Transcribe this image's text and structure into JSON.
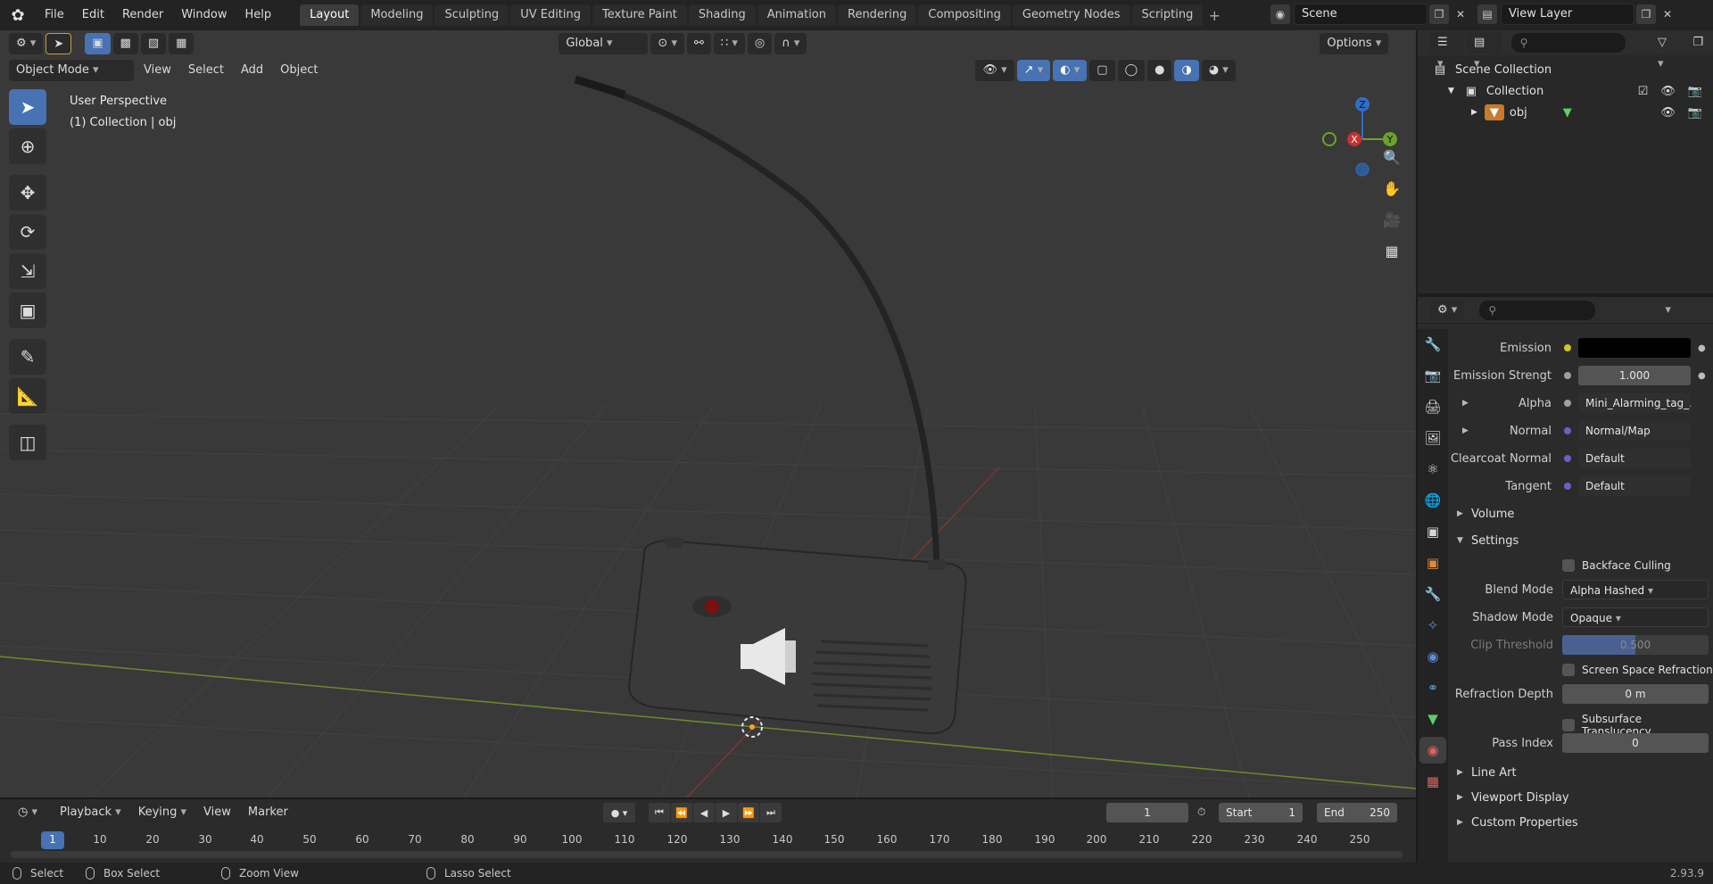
{
  "topbar": {
    "menus": [
      "File",
      "Edit",
      "Render",
      "Window",
      "Help"
    ],
    "workspaces": [
      "Layout",
      "Modeling",
      "Sculpting",
      "UV Editing",
      "Texture Paint",
      "Shading",
      "Animation",
      "Rendering",
      "Compositing",
      "Geometry Nodes",
      "Scripting"
    ],
    "active_workspace": "Layout",
    "scene": "Scene",
    "view_layer": "View Layer"
  },
  "viewport": {
    "transform_orientation": "Global",
    "options_label": "Options",
    "mode": "Object Mode",
    "menus": [
      "View",
      "Select",
      "Add",
      "Object"
    ],
    "perspective_label": "User Perspective",
    "collection_label": "(1) Collection | obj",
    "gizmo": {
      "z": "Z",
      "x": "X",
      "y": "Y"
    }
  },
  "outliner": {
    "scene_collection": "Scene Collection",
    "collection": "Collection",
    "object": "obj"
  },
  "properties": {
    "emission_label": "Emission",
    "emission_strength_label": "Emission Strengt",
    "emission_strength_value": "1.000",
    "alpha_label": "Alpha",
    "alpha_value": "Mini_Alarming_tag_...",
    "normal_label": "Normal",
    "normal_value": "Normal/Map",
    "clearcoat_normal_label": "Clearcoat Normal",
    "clearcoat_normal_value": "Default",
    "tangent_label": "Tangent",
    "tangent_value": "Default",
    "volume_section": "Volume",
    "settings_section": "Settings",
    "backface_culling": "Backface Culling",
    "blend_mode_label": "Blend Mode",
    "blend_mode_value": "Alpha Hashed",
    "shadow_mode_label": "Shadow Mode",
    "shadow_mode_value": "Opaque",
    "clip_threshold_label": "Clip Threshold",
    "clip_threshold_value": "0.500",
    "screen_space_refraction": "Screen Space Refraction",
    "refraction_depth_label": "Refraction Depth",
    "refraction_depth_value": "0 m",
    "subsurface_translucency": "Subsurface Translucency",
    "pass_index_label": "Pass Index",
    "pass_index_value": "0",
    "line_art_section": "Line Art",
    "viewport_display_section": "Viewport Display",
    "custom_properties_section": "Custom Properties"
  },
  "timeline": {
    "menus": [
      "Playback",
      "Keying",
      "View",
      "Marker"
    ],
    "current_frame": "1",
    "start_label": "Start",
    "start_value": "1",
    "end_label": "End",
    "end_value": "250",
    "ruler": [
      "1",
      "10",
      "20",
      "30",
      "40",
      "50",
      "60",
      "70",
      "80",
      "90",
      "100",
      "110",
      "120",
      "130",
      "140",
      "150",
      "160",
      "170",
      "180",
      "190",
      "200",
      "210",
      "220",
      "230",
      "240",
      "250"
    ]
  },
  "statusbar": {
    "select": "Select",
    "box_select": "Box Select",
    "zoom_view": "Zoom View",
    "lasso_select": "Lasso Select",
    "version": "2.93.9"
  }
}
